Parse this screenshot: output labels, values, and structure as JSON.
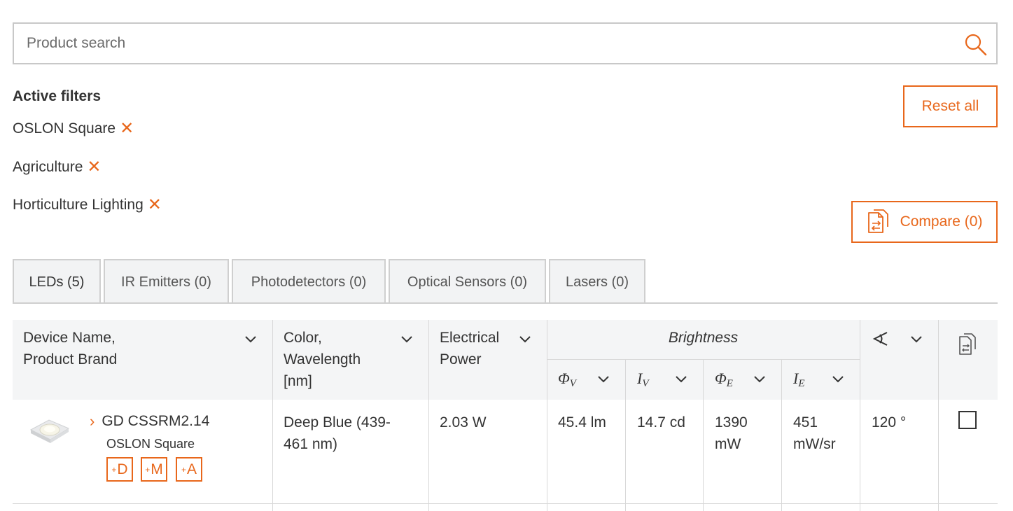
{
  "search": {
    "placeholder": "Product search",
    "icon": "search-icon"
  },
  "filters": {
    "title": "Active filters",
    "items": [
      {
        "label": "OSLON Square"
      },
      {
        "label": "Agriculture"
      },
      {
        "label": "Horticulture Lighting"
      }
    ],
    "remove_glyph": "✕",
    "reset_label": "Reset all",
    "compare_label": "Compare (0)"
  },
  "tabs": [
    {
      "label": "LEDs (5)",
      "active": true
    },
    {
      "label": "IR Emitters (0)",
      "active": false
    },
    {
      "label": "Photodetectors (0)",
      "active": false
    },
    {
      "label": "Optical Sensors (0)",
      "active": false
    },
    {
      "label": "Lasers (0)",
      "active": false
    }
  ],
  "table": {
    "headers": {
      "device_line1": "Device Name,",
      "device_line2": "Product Brand",
      "color_line1": "Color,",
      "color_line2": "Wavelength",
      "color_line3": "[nm]",
      "power_line1": "Electrical",
      "power_line2": "Power",
      "brightness": "Brightness",
      "phi_v": "Φ",
      "phi_v_sub": "V",
      "i_v": "I",
      "i_v_sub": "V",
      "phi_e": "Φ",
      "phi_e_sub": "E",
      "i_e": "I",
      "i_e_sub": "E"
    },
    "rows": [
      {
        "name": "GD CSSRM2.14",
        "brand": "OSLON Square",
        "badges": [
          "D",
          "M",
          "A"
        ],
        "badge_prefix": "+",
        "color_line1": "Deep Blue (439-",
        "color_line2": "461 nm)",
        "power": "2.03 W",
        "phi_v": "45.4 lm",
        "i_v": "14.7 cd",
        "phi_e_line1": "1390",
        "phi_e_line2": "mW",
        "i_e_line1": "451",
        "i_e_line2": "mW/sr",
        "angle": "120 °"
      }
    ]
  },
  "colors": {
    "accent": "#e8671b",
    "header_bg": "#f4f5f6",
    "border": "#cfcfcf"
  }
}
